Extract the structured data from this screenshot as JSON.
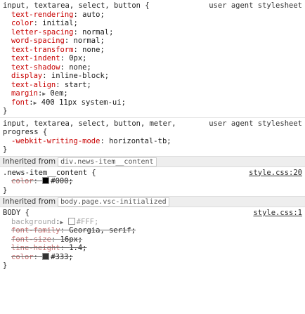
{
  "rule1": {
    "selector": "input, textarea, select, button {",
    "origin": "user agent stylesheet",
    "decls": [
      {
        "prop": "text-rendering",
        "val": "auto;"
      },
      {
        "prop": "color",
        "val": "initial;"
      },
      {
        "prop": "letter-spacing",
        "val": "normal;"
      },
      {
        "prop": "word-spacing",
        "val": "normal;"
      },
      {
        "prop": "text-transform",
        "val": "none;"
      },
      {
        "prop": "text-indent",
        "val": "0px;"
      },
      {
        "prop": "text-shadow",
        "val": "none;"
      },
      {
        "prop": "display",
        "val": "inline-block;"
      },
      {
        "prop": "text-align",
        "val": "start;"
      },
      {
        "prop": "margin",
        "val": "0em;"
      },
      {
        "prop": "font",
        "val": "400 11px system-ui;"
      }
    ],
    "close": "}"
  },
  "rule2": {
    "selector_line1": "input, textarea, select, button, meter,",
    "selector_line2": "progress {",
    "origin": "user agent stylesheet",
    "decl": {
      "prop": "-webkit-writing-mode",
      "val": "horizontal-tb;"
    },
    "close": "}"
  },
  "inherited1": {
    "label": "Inherited from",
    "chip": "div.news-item__content"
  },
  "rule3": {
    "selector": ".news-item__content {",
    "origin": "style.css:20",
    "decl": {
      "prop": "color",
      "val": "#000;"
    },
    "close": "}"
  },
  "inherited2": {
    "label": "Inherited from",
    "chip": "body.page.vsc-initialized"
  },
  "rule4": {
    "selector": "BODY {",
    "origin": "style.css:1",
    "decls": [
      {
        "prop": "background",
        "val": "#FFF;"
      },
      {
        "prop": "font-family",
        "val": "Georgia, serif;"
      },
      {
        "prop": "font-size",
        "val": "16px;"
      },
      {
        "prop": "line-height",
        "val": "1.4;"
      },
      {
        "prop": "color",
        "val": "#333;"
      }
    ],
    "close": "}"
  },
  "colors": {
    "swatch_black": "#000000",
    "swatch_white": "#FFFFFF",
    "swatch_dark": "#333333"
  },
  "icons": {
    "expand": "triangle-right-icon"
  }
}
